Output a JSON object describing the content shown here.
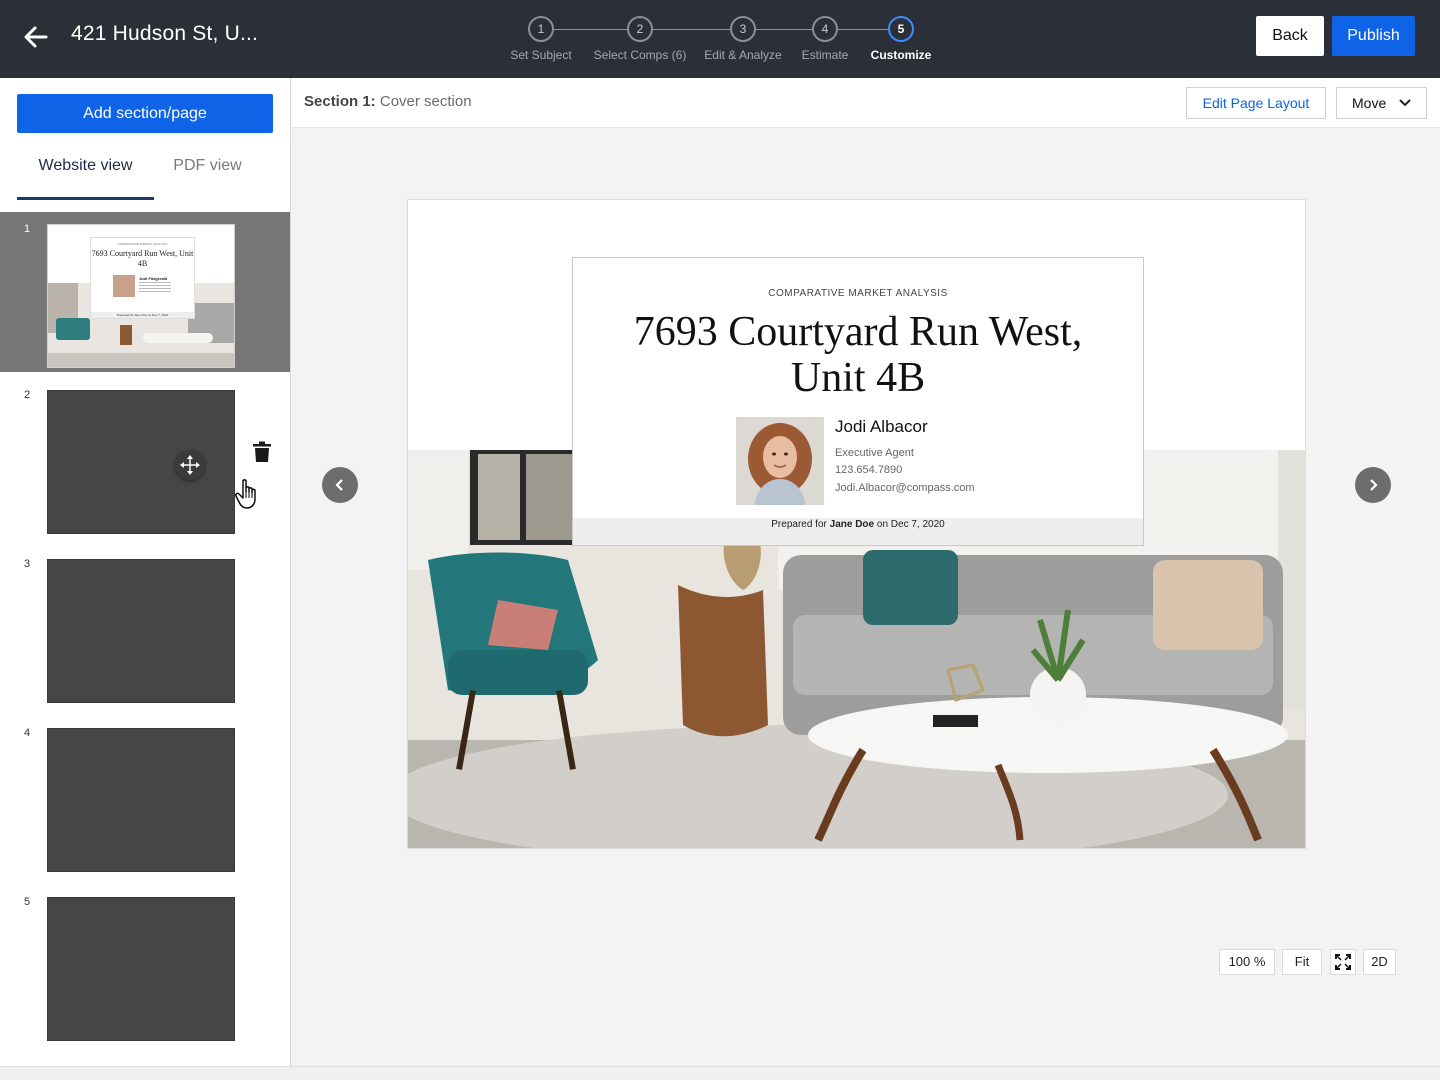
{
  "header": {
    "title": "421 Hudson St,  U...",
    "steps": [
      {
        "number": "1",
        "label": "Set Subject"
      },
      {
        "number": "2",
        "label": "Select Comps (6)"
      },
      {
        "number": "3",
        "label": "Edit & Analyze"
      },
      {
        "number": "4",
        "label": "Estimate"
      },
      {
        "number": "5",
        "label": "Customize"
      }
    ],
    "active_step": 5,
    "back_label": "Back",
    "publish_label": "Publish"
  },
  "sidebar": {
    "add_label": "Add section/page",
    "tabs": [
      {
        "label": "Website view",
        "active": true
      },
      {
        "label": "PDF view",
        "active": false
      }
    ],
    "pages": [
      "1",
      "2",
      "3",
      "4",
      "5"
    ],
    "selected_page": "1",
    "thumb": {
      "subtitle": "COMPARATIVE MARKET ANALYSIS",
      "title": "7693 Courtyard Run West, Unit 4B",
      "name": "Jodi Fitzgerald",
      "prepared": "Prepared for Jane Doe on Dec 7, 2020"
    }
  },
  "main": {
    "section_label": "Section 1:",
    "section_name": "Cover section",
    "edit_layout_label": "Edit Page Layout",
    "move_label": "Move",
    "zoom": "100 %",
    "fit_label": "Fit",
    "mode_label": "2D"
  },
  "cover": {
    "subtitle": "COMPARATIVE MARKET ANALYSIS",
    "title_line1": "7693 Courtyard Run West,",
    "title_line2": "Unit 4B",
    "agent_name": "Jodi Albacor",
    "agent_role": "Executive Agent",
    "agent_phone": "123.654.7890",
    "agent_email": "Jodi.Albacor@compass.com",
    "prepared_prefix": "Prepared for",
    "prepared_name": "Jane Doe",
    "prepared_suffix": "on Dec 7, 2020"
  },
  "colors": {
    "topbar": "#2b2f38",
    "primary": "#0f63e6",
    "active_step": "#3d8bff",
    "selected_page_bg": "#767676",
    "page_thumb": "#464646"
  },
  "icons": {
    "back": "arrow-left-icon",
    "move": "move-arrows-icon",
    "cursor": "hand-pointer-icon",
    "delete": "trash-icon",
    "prev": "chevron-left-icon",
    "next": "chevron-right-icon",
    "fullscreen": "expand-icon",
    "dropdown": "chevron-down-icon"
  }
}
